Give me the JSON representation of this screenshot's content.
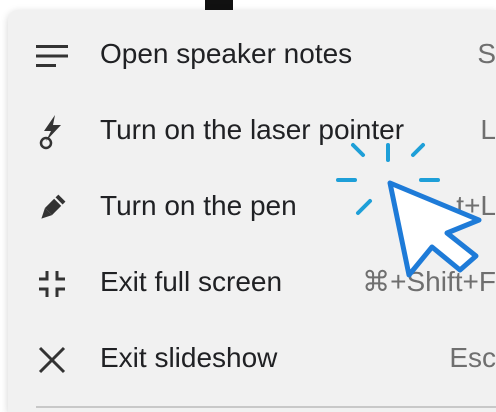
{
  "menu": {
    "items": [
      {
        "label": "Open speaker notes",
        "shortcut": "S",
        "icon": "speaker-notes-icon"
      },
      {
        "label": "Turn on the laser pointer",
        "shortcut": "L",
        "icon": "laser-pointer-icon"
      },
      {
        "label": "Turn on the pen",
        "shortcut": "t+L",
        "icon": "pen-icon"
      },
      {
        "label": "Exit full screen",
        "shortcut": "⌘+Shift+F",
        "icon": "exit-fullscreen-icon"
      },
      {
        "label": "Exit slideshow",
        "shortcut": "Esc",
        "icon": "close-icon"
      }
    ]
  },
  "overlay": {
    "icon": "click-cursor-icon",
    "color": "#1e9fd8"
  }
}
